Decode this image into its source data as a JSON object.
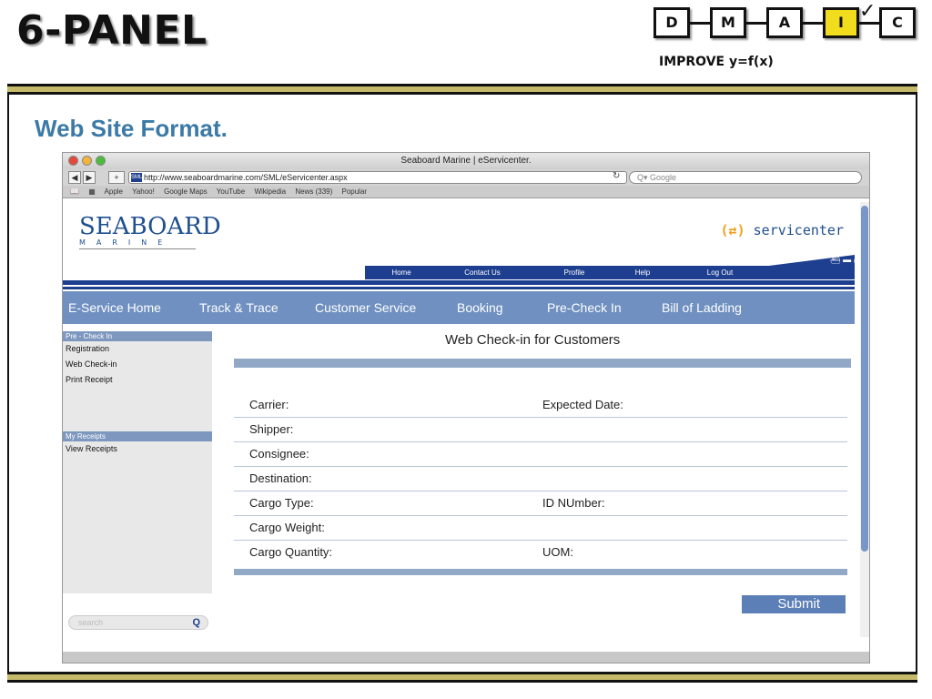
{
  "slide": {
    "title": "6-PANEL",
    "dmaic": [
      "D",
      "M",
      "A",
      "I",
      "C"
    ],
    "dmaic_active": "I",
    "subtitle": "IMPROVE y=f(x)",
    "heading": "Web Site Format."
  },
  "browser": {
    "window_title": "Seaboard Marine | eServicenter.",
    "url": "http://www.seaboardmarine.com/SML/eServicenter.aspx",
    "search_placeholder": "Google",
    "bookmarks": [
      "Apple",
      "Yahoo!",
      "Google Maps",
      "YouTube",
      "Wikipedia",
      "News (339)",
      "Popular"
    ]
  },
  "site": {
    "logo_word": "SEABOARD",
    "logo_sub": "MARINE",
    "servicenter": "servicenter",
    "top_nav": [
      "Home",
      "Contact Us",
      "Profile",
      "Help",
      "Log Out"
    ],
    "main_nav": [
      "E-Service Home",
      "Track & Trace",
      "Customer Service",
      "Booking",
      "Pre-Check In",
      "Bill of Ladding"
    ],
    "sidebar": {
      "group1_title": "Pre - Check In",
      "group1_items": [
        "Registration",
        "Web Check-in",
        "Print Receipt"
      ],
      "group2_title": "My Receipts",
      "group2_items": [
        "View Receipts"
      ],
      "search_placeholder": "search"
    },
    "form": {
      "title": "Web Check-in for Customers",
      "rows": [
        {
          "left": "Carrier:",
          "right": "Expected Date:"
        },
        {
          "left": "Shipper:",
          "right": ""
        },
        {
          "left": "Consignee:",
          "right": ""
        },
        {
          "left": "Destination:",
          "right": ""
        },
        {
          "left": "Cargo Type:",
          "right": "ID NUmber:"
        },
        {
          "left": "Cargo Weight:",
          "right": ""
        },
        {
          "left": "Cargo Quantity:",
          "right": "UOM:"
        }
      ],
      "submit": "Submit"
    }
  },
  "colors": {
    "brand_blue": "#1e3f8f",
    "nav_blue": "#6f90c0",
    "heading_blue": "#3b7aa6",
    "dmaic_active": "#f2dc1e"
  }
}
